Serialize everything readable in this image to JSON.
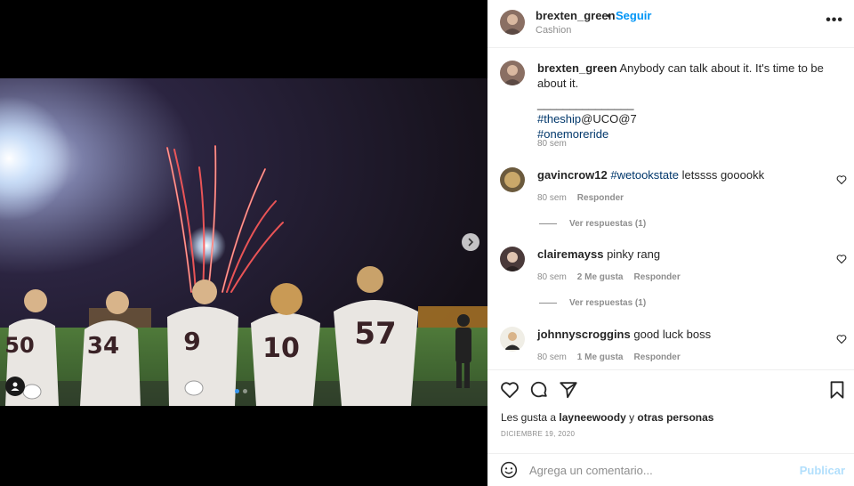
{
  "post": {
    "username": "brexten_green",
    "separator": "•",
    "follow_label": "Seguir",
    "subtitle": "Cashion",
    "more_icon": "more-horizontal-icon"
  },
  "caption": {
    "username": "brexten_green",
    "text": "Anybody can talk about it. It's time to be about it.",
    "divider": "_______________",
    "line1_hashtag": "#theship",
    "line1_rest": "@UCO@7",
    "line2_hashtag": "#onemoreride",
    "time": "80 sem"
  },
  "comments": [
    {
      "username": "gavincrow12",
      "hashtag": "#wetookstate",
      "text": " letssss gooookk",
      "time": "80 sem",
      "likes": "",
      "reply_label": "Responder",
      "view_replies": "Ver respuestas (1)"
    },
    {
      "username": "clairemayss",
      "hashtag": "",
      "text": "pinky rang",
      "time": "80 sem",
      "likes": "2 Me gusta",
      "reply_label": "Responder",
      "view_replies": "Ver respuestas (1)"
    },
    {
      "username": "johnnyscroggins",
      "hashtag": "",
      "text": "good luck boss",
      "time": "80 sem",
      "likes": "1 Me gusta",
      "reply_label": "Responder",
      "view_replies": ""
    }
  ],
  "likes": {
    "prefix": "Les gusta a ",
    "user": "layneewoody",
    "mid": " y ",
    "others": "otras personas"
  },
  "date": "DICIEMBRE 19, 2020",
  "add_comment": {
    "placeholder": "Agrega un comentario...",
    "post_label": "Publicar"
  },
  "photo": {
    "jerseys": [
      "50",
      "34",
      "9",
      "10",
      "57"
    ]
  },
  "colors": {
    "link_blue": "#0095f6",
    "hashtag_blue": "#00376b",
    "muted_gray": "#8e8e8e",
    "carousel_active": "#3897f0"
  }
}
